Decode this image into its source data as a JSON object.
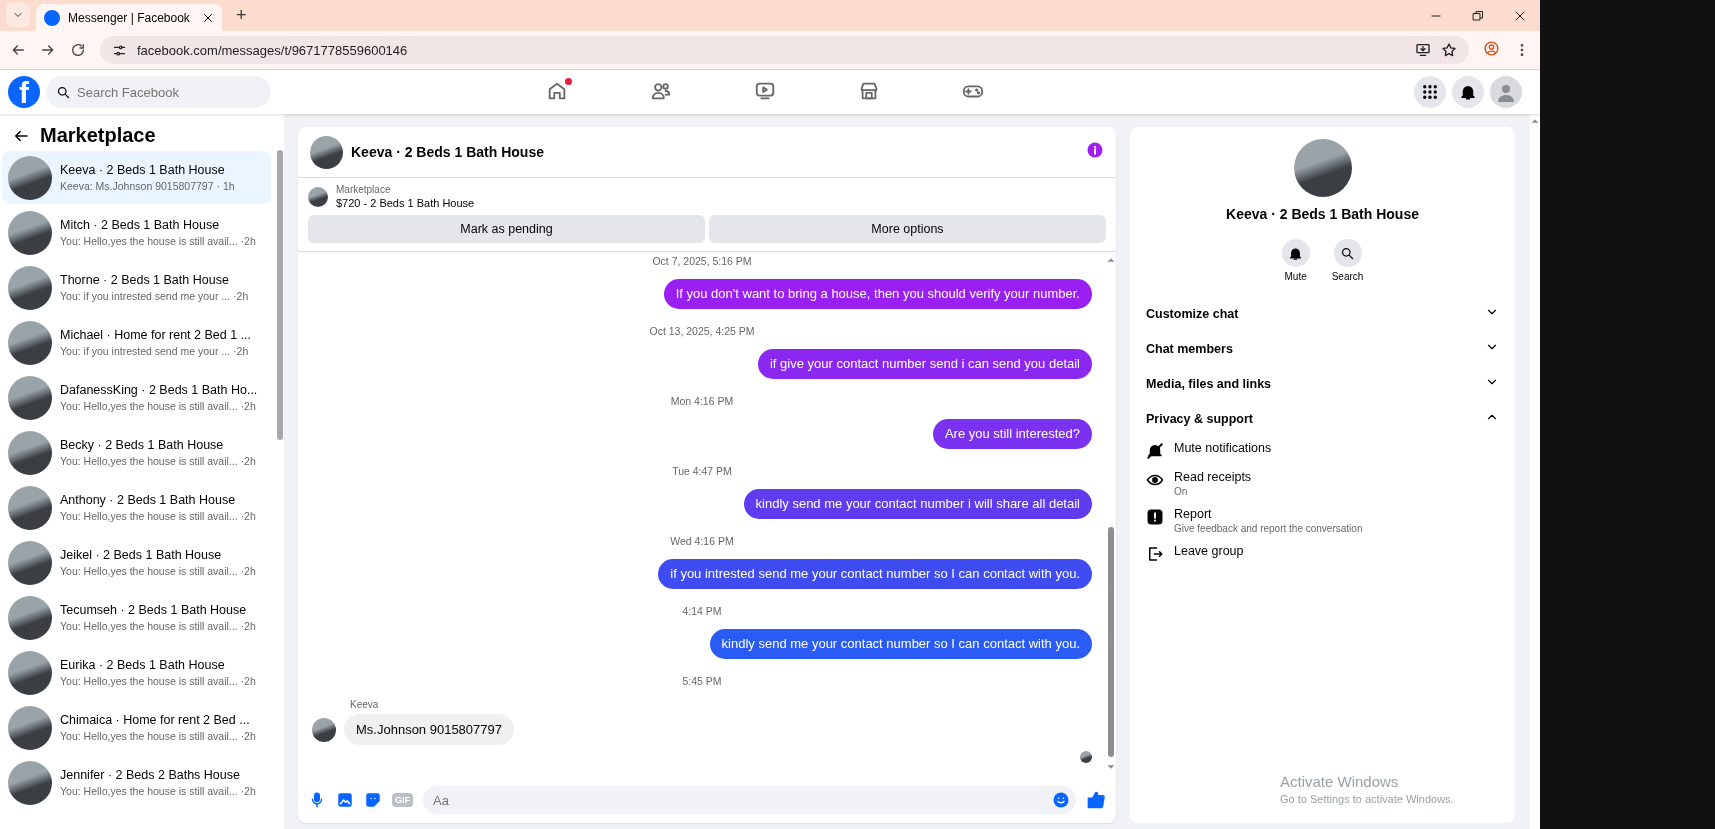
{
  "browser": {
    "tab_title": "Messenger | Facebook",
    "new_tab": "+",
    "url": "facebook.com/messages/t/9671778559600146"
  },
  "header": {
    "logo": "f",
    "search_placeholder": "Search Facebook",
    "nav": [
      {
        "kind": "home",
        "dot": true
      },
      {
        "kind": "friends",
        "dot": false
      },
      {
        "kind": "video",
        "dot": false
      },
      {
        "kind": "marketplace",
        "dot": false
      },
      {
        "kind": "gaming",
        "dot": false
      }
    ]
  },
  "sidebar": {
    "title": "Marketplace",
    "conversations": [
      {
        "title": "Keeva · 2 Beds 1 Bath House",
        "preview": "Keeva: Ms.Johnson 9015807797",
        "time": "· 1h",
        "selected": true
      },
      {
        "title": "Mitch · 2 Beds 1 Bath House",
        "preview": "You: Hello,yes the house is still avail...",
        "time": "·2h",
        "selected": false
      },
      {
        "title": "Thorne · 2 Beds 1 Bath House",
        "preview": "You: if you intrested send me your ...",
        "time": "·2h",
        "selected": false
      },
      {
        "title": "Michael · Home for rent 2 Bed 1 ...",
        "preview": "You: if you intrested send me your ...",
        "time": "·2h",
        "selected": false
      },
      {
        "title": "DafanessKing · 2 Beds 1 Bath Ho...",
        "preview": "You: Hello,yes the house is still avail...",
        "time": "·2h",
        "selected": false
      },
      {
        "title": "Becky · 2 Beds 1 Bath House",
        "preview": "You: Hello,yes the house is still avail...",
        "time": "·2h",
        "selected": false
      },
      {
        "title": "Anthony · 2 Beds 1 Bath House",
        "preview": "You: Hello,yes the house is still avail...",
        "time": "·2h",
        "selected": false
      },
      {
        "title": "Jeikel · 2 Beds 1 Bath House",
        "preview": "You: Hello,yes the house is still avail...",
        "time": "·2h",
        "selected": false
      },
      {
        "title": "Tecumseh · 2 Beds 1 Bath House",
        "preview": "You: Hello,yes the house is still avail...",
        "time": "·2h",
        "selected": false
      },
      {
        "title": "Eurika · 2 Beds 1 Bath House",
        "preview": "You: Hello,yes the house is still avail...",
        "time": "·2h",
        "selected": false
      },
      {
        "title": "Chimaica · Home for rent 2 Bed ...",
        "preview": "You: Hello,yes the house is still avail...",
        "time": "·2h",
        "selected": false
      },
      {
        "title": "Jennifer · 2 Beds 2 Baths House",
        "preview": "You: Hello,yes the house is still avail...",
        "time": "·2h",
        "selected": false
      }
    ]
  },
  "chat": {
    "title": "Keeva · 2 Beds 1 Bath House",
    "listing": {
      "label": "Marketplace",
      "item": "$720 - 2 Beds 1 Bath House"
    },
    "buttons": [
      "Mark as pending",
      "More options"
    ],
    "messages": [
      {
        "kind": "timestamp",
        "text": "Oct 7, 2025, 5:16 PM"
      },
      {
        "kind": "outgoing",
        "text": "If you don't want to bring a house, then you should verify your number.",
        "color": "#9a1ff2"
      },
      {
        "kind": "timestamp",
        "text": "Oct 13, 2025, 4:25 PM"
      },
      {
        "kind": "outgoing",
        "text": "if give your contact number send i can send you detail",
        "color": "#8a27f0"
      },
      {
        "kind": "timestamp",
        "text": "Mon 4:16 PM"
      },
      {
        "kind": "outgoing",
        "text": "Are you still interested?",
        "color": "#7b31f0"
      },
      {
        "kind": "timestamp",
        "text": "Tue 4:47 PM"
      },
      {
        "kind": "outgoing",
        "text": "kindly send me your contact number i will share all detail",
        "color": "#5f3cf0"
      },
      {
        "kind": "timestamp",
        "text": "Wed 4:16 PM"
      },
      {
        "kind": "outgoing",
        "text": "if you intrested send me your contact number  so I can contact with you.",
        "color": "#3f4cf2"
      },
      {
        "kind": "timestamp",
        "text": "4:14 PM"
      },
      {
        "kind": "outgoing",
        "text": "kindly send me your contact number so I can contact with you.",
        "color": "#2a5cf5"
      },
      {
        "kind": "timestamp",
        "text": "5:45 PM"
      },
      {
        "kind": "incoming",
        "sender": "Keeva",
        "text": "Ms.Johnson 9015807797"
      }
    ],
    "composer": {
      "gif": "GIF",
      "placeholder": "Aa"
    }
  },
  "details": {
    "title": "Keeva · 2 Beds 1 Bath House",
    "actions": [
      {
        "kind": "mute",
        "label": "Mute"
      },
      {
        "kind": "search",
        "label": "Search"
      }
    ],
    "sections": [
      {
        "label": "Customize chat",
        "expanded": false
      },
      {
        "label": "Chat members",
        "expanded": false
      },
      {
        "label": "Media, files and links",
        "expanded": false
      },
      {
        "label": "Privacy & support",
        "expanded": true,
        "children": [
          {
            "kind": "mute",
            "label": "Mute notifications"
          },
          {
            "kind": "receipts",
            "label": "Read receipts",
            "sub": "On"
          },
          {
            "kind": "report",
            "label": "Report",
            "sub": "Give feedback and report the conversation"
          },
          {
            "kind": "leave",
            "label": "Leave group"
          }
        ]
      }
    ]
  },
  "os_notice": {
    "title": "Activate Windows",
    "subtitle": "Go to Settings to activate Windows."
  }
}
